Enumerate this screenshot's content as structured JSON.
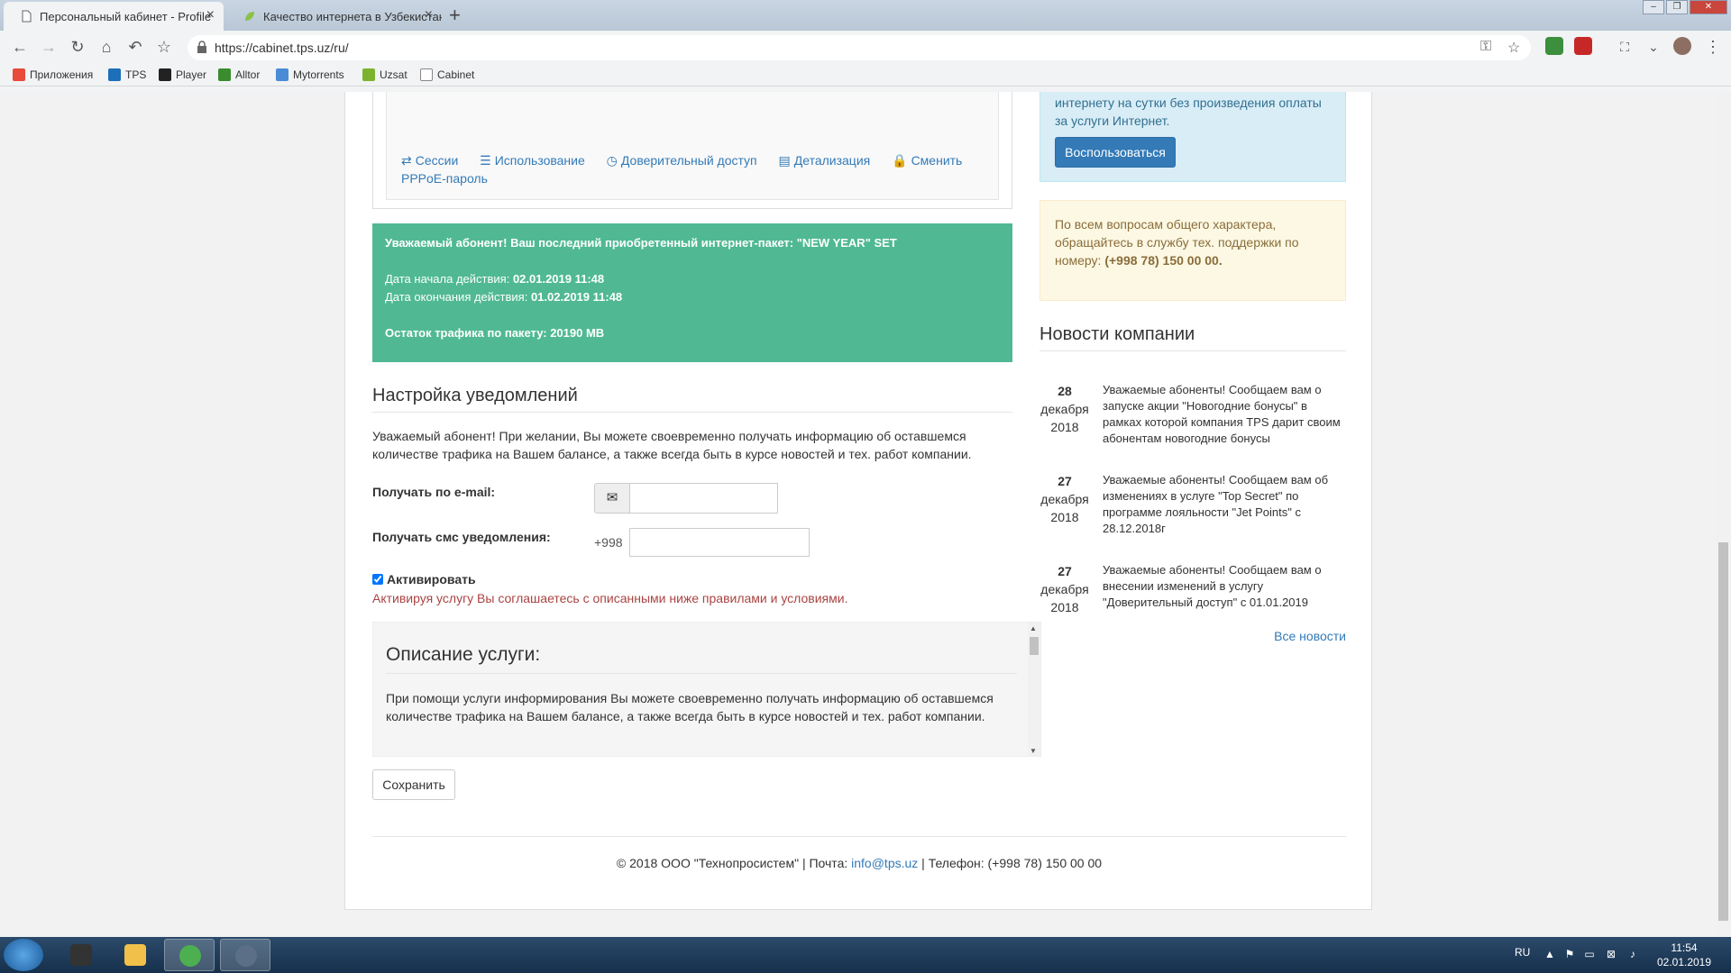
{
  "browser": {
    "tabs": [
      {
        "title": "Персональный кабинет - Profile",
        "active": true
      },
      {
        "title": "Качество интернета в Узбекистане",
        "active": false
      }
    ],
    "url": "https://cabinet.tps.uz/ru/",
    "bookmarks": [
      {
        "label": "Приложения",
        "icon": "apps-grid-icon",
        "color": "#e84a3c"
      },
      {
        "label": "TPS",
        "icon": "tps-icon",
        "color": "#1c6fb8"
      },
      {
        "label": "Player",
        "icon": "player-icon",
        "color": "#222222"
      },
      {
        "label": "Alltor",
        "icon": "alltor-icon",
        "color": "#3a8c2f"
      },
      {
        "label": "Mytorrents",
        "icon": "mytorrents-icon",
        "color": "#4a8bd6"
      },
      {
        "label": "Uzsat",
        "icon": "uzsat-icon",
        "color": "#7bb32e"
      },
      {
        "label": "Cabinet",
        "icon": "page-icon",
        "color": "#888888"
      }
    ]
  },
  "profile": {
    "links": [
      {
        "icon": "⇄",
        "label": "Сессии"
      },
      {
        "icon": "☰",
        "label": "Использование"
      },
      {
        "icon": "◷",
        "label": "Доверительный доступ"
      },
      {
        "icon": "▤",
        "label": "Детализация"
      },
      {
        "icon": "🔒",
        "label": "Сменить PPPoE-пароль"
      }
    ]
  },
  "package": {
    "intro": "Уважаемый абонент! Ваш последний приобретенный интернет-пакет: \"NEW YEAR\" SET",
    "start_label": "Дата начала действия:",
    "start_value": "02.01.2019 11:48",
    "end_label": "Дата окончания действия:",
    "end_value": "01.02.2019 11:48",
    "traffic_label": "Остаток трафика по пакету:",
    "traffic_value": "20190 MB"
  },
  "notifications": {
    "title": "Настройка уведомлений",
    "description": "Уважаемый абонент! При желании, Вы можете своевременно получать информацию об оставшемся количестве трафика на Вашем балансе, а также всегда быть в курсе новостей и тех. работ компании.",
    "email_label": "Получать по e-mail:",
    "email_value": "",
    "sms_label": "Получать смс уведомления:",
    "sms_prefix": "+998",
    "sms_value": "",
    "activate_label": "Активировать",
    "activate_checked": true,
    "activate_note": "Активируя услугу Вы соглашаетесь с описанными ниже правилами и условиями.",
    "desc_title": "Описание услуги:",
    "desc_text": "При помощи услуги информирования Вы можете своевременно получать информацию об оставшемся количестве трафика на Вашем балансе, а также всегда быть в курсе новостей и тех. работ компании.",
    "save_label": "Сохранить"
  },
  "trust": {
    "text": "интернету на сутки без произведения оплаты за услуги Интернет.",
    "button": "Воспользоваться"
  },
  "support": {
    "text": "По всем вопросам общего характера, обращайтесь в службу тех. поддержки по номеру:",
    "phone": "(+998 78) 150 00 00."
  },
  "news": {
    "title": "Новости компании",
    "items": [
      {
        "day": "28",
        "month": "декабря",
        "year": "2018",
        "text": "Уважаемые абоненты! Сообщаем вам о запуске акции \"Новогодние бонусы\" в рамках которой компания TPS дарит своим абонентам новогодние бонусы"
      },
      {
        "day": "27",
        "month": "декабря",
        "year": "2018",
        "text": "Уважаемые абоненты! Сообщаем вам об изменениях в услуге \"Top Secret\" по программе лояльности \"Jet Points\" с 28.12.2018г"
      },
      {
        "day": "27",
        "month": "декабря",
        "year": "2018",
        "text": "Уважаемые абоненты! Сообщаем вам о внесении изменений в услугу \"Доверительный доступ\" с 01.01.2019"
      }
    ],
    "all_link": "Все новости"
  },
  "footer": {
    "copyright": "© 2018 ООО \"Технопросистем\" | Почта:",
    "email": "info@tps.uz",
    "phone": "| Телефон: (+998 78) 150 00 00"
  },
  "taskbar": {
    "lang": "RU",
    "time": "11:54",
    "date": "02.01.2019"
  },
  "colors": {
    "package_bg": "#50b994",
    "link": "#337ab7",
    "primary_button": "#337ab7",
    "danger_text": "#a94442"
  }
}
